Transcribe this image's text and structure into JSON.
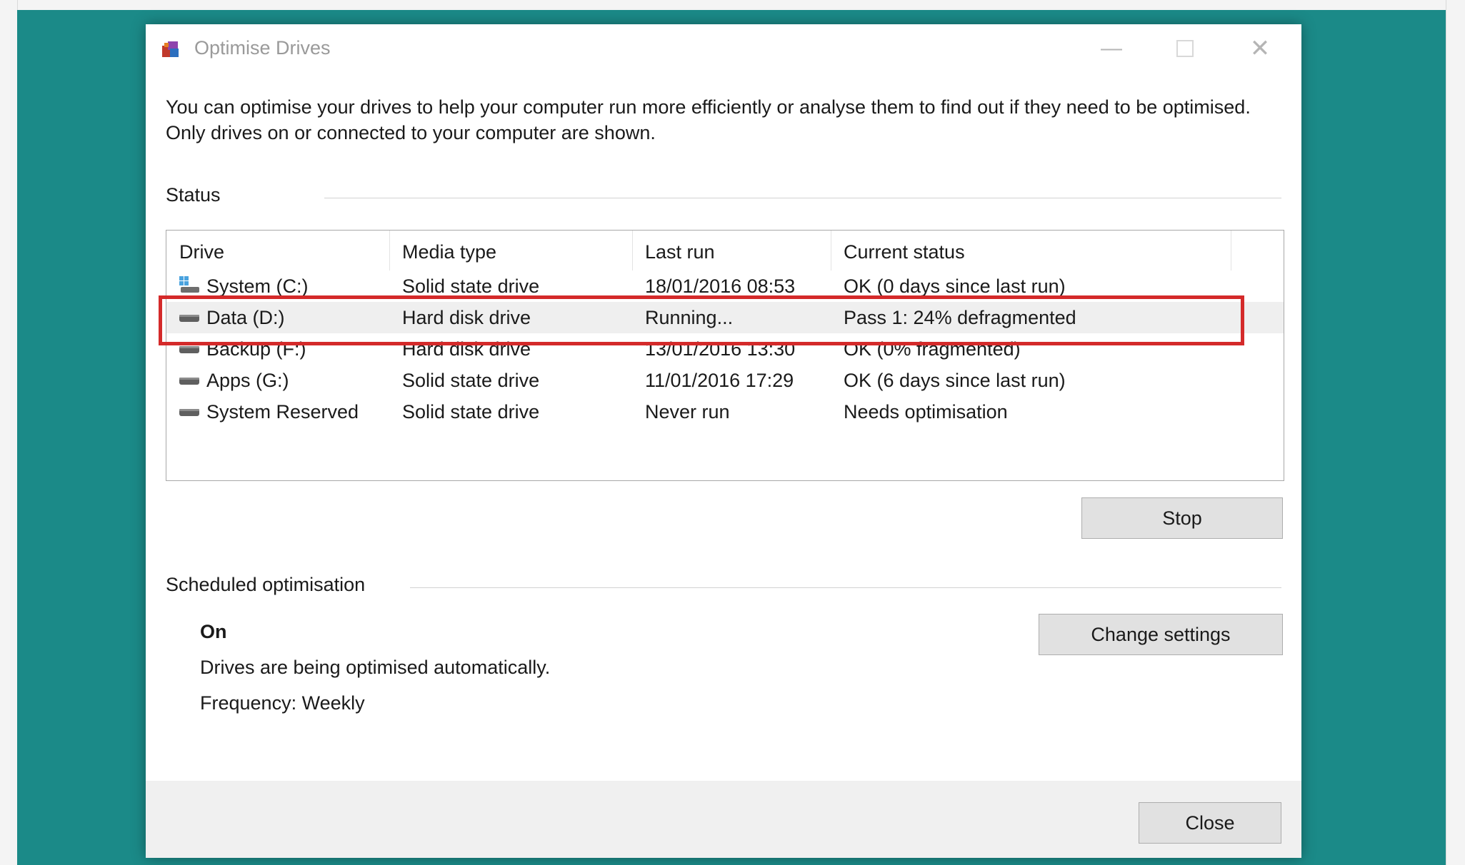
{
  "window": {
    "title": "Optimise Drives",
    "description": "You can optimise your drives to help your computer run more efficiently or analyse them to find out if they need to be optimised. Only drives on or connected to your computer are shown."
  },
  "status": {
    "group_label": "Status",
    "columns": [
      "Drive",
      "Media type",
      "Last run",
      "Current status"
    ],
    "rows": [
      {
        "drive": "System (C:)",
        "media": "Solid state drive",
        "last_run": "18/01/2016 08:53",
        "status": "OK (0 days since last run)",
        "icon": "windows-drive-icon"
      },
      {
        "drive": "Data (D:)",
        "media": "Hard disk drive",
        "last_run": "Running...",
        "status": "Pass 1: 24% defragmented",
        "icon": "hard-drive-icon",
        "selected": true
      },
      {
        "drive": "Backup (F:)",
        "media": "Hard disk drive",
        "last_run": "13/01/2016 13:30",
        "status": "OK (0% fragmented)",
        "icon": "hard-drive-icon"
      },
      {
        "drive": "Apps (G:)",
        "media": "Solid state drive",
        "last_run": "11/01/2016 17:29",
        "status": "OK (6 days since last run)",
        "icon": "hard-drive-icon"
      },
      {
        "drive": "System Reserved",
        "media": "Solid state drive",
        "last_run": "Never run",
        "status": "Needs optimisation",
        "icon": "hard-drive-icon"
      }
    ],
    "stop_label": "Stop"
  },
  "schedule": {
    "group_label": "Scheduled optimisation",
    "state": "On",
    "info": "Drives are being optimised automatically.",
    "frequency": "Frequency: Weekly",
    "change_label": "Change settings"
  },
  "footer": {
    "close_label": "Close"
  },
  "colors": {
    "desktop": "#1b8a88",
    "highlight": "#d42a2a",
    "selected_row": "#efefef"
  }
}
